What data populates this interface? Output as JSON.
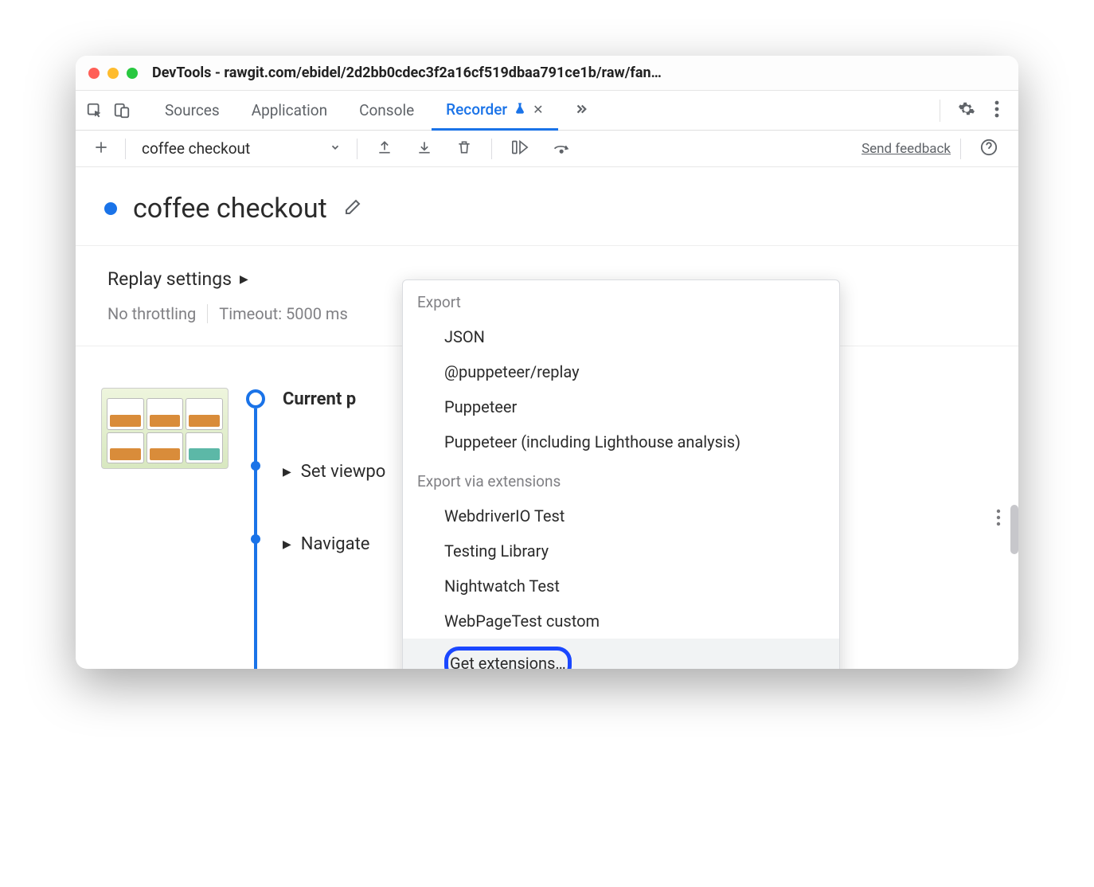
{
  "window": {
    "title": "DevTools - rawgit.com/ebidel/2d2bb0cdec3f2a16cf519dbaa791ce1b/raw/fan…"
  },
  "tabs": {
    "sources": "Sources",
    "application": "Application",
    "console": "Console",
    "recorder": "Recorder"
  },
  "toolbar": {
    "recording_name": "coffee checkout",
    "send_feedback": "Send feedback"
  },
  "heading": {
    "title": "coffee checkout"
  },
  "settings": {
    "title": "Replay settings",
    "throttling": "No throttling",
    "timeout": "Timeout: 5000 ms"
  },
  "steps": {
    "current_partial": "Current p",
    "set_viewport_partial": "Set viewpo",
    "navigate": "Navigate"
  },
  "popover": {
    "section_export": "Export",
    "json": "JSON",
    "puppeteer_replay": "@puppeteer/replay",
    "puppeteer": "Puppeteer",
    "puppeteer_lighthouse": "Puppeteer (including Lighthouse analysis)",
    "section_ext": "Export via extensions",
    "webdriverio": "WebdriverIO Test",
    "testing_library": "Testing Library",
    "nightwatch": "Nightwatch Test",
    "webpagetest": "WebPageTest custom",
    "get_extensions": "Get extensions…"
  }
}
